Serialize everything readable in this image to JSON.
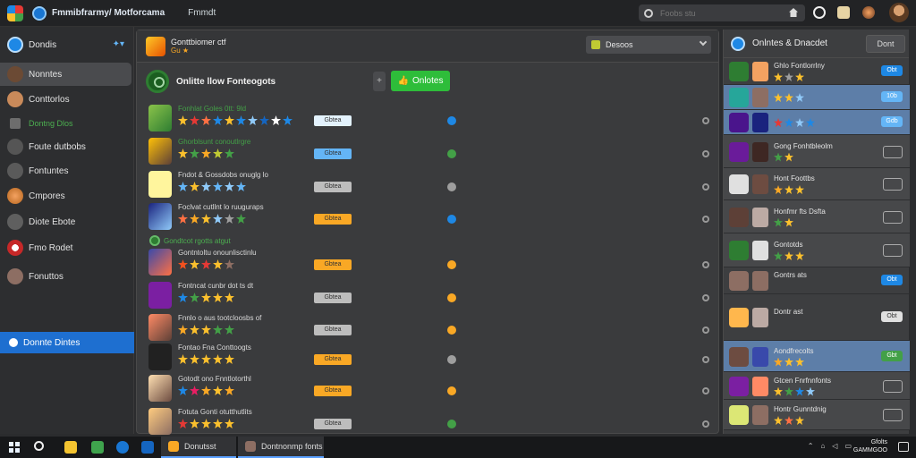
{
  "titlebar": {
    "app_title": "Fmmibfrarmy/ Motforcama",
    "subtitle": "Fmmdt",
    "search_placeholder": "Foobs stu"
  },
  "sidebar": {
    "top_label": "Dondis",
    "items": [
      {
        "label": "Nonntes",
        "active": true
      },
      {
        "label": "Conttorlos"
      },
      {
        "label": "Dontng Dlos",
        "green": true
      },
      {
        "label": "Foute dutbobs"
      },
      {
        "label": "Fontuntes"
      },
      {
        "label": "Cmpores"
      },
      {
        "label": "Diote Ebote"
      },
      {
        "label": "Fmo Rodet"
      },
      {
        "label": "Fonuttos"
      }
    ],
    "blue_item": "Donnte Dintes"
  },
  "main": {
    "header_title": "Gonttbiomer ctf",
    "header_sub": "Gu ★",
    "dropdown_value": "Desoos",
    "section_title": "Onlitte llow Fonteogots",
    "section_button": "Onlotes",
    "subsection_label": "Gondtcot rgotts atgut",
    "rows": [
      {
        "name": "Fonhlat Goles 0tt: 9ld",
        "badge": "Gbtea",
        "badge_color": "#e3f2fd",
        "dot_color": "#1e88e5",
        "name_green": true
      },
      {
        "name": "Ghorblsunt conoutlrgre",
        "badge": "Gbtea",
        "badge_color": "#64b5f6",
        "dot_color": "#43a047",
        "name_green": true
      },
      {
        "name": "Fndot & Gossdobs onuglg lo",
        "badge": "Gbtea",
        "badge_color": "#bdbdbd",
        "dot_color": "#9e9e9e"
      },
      {
        "name": "Foclvat cutllnt lo ruuguraps",
        "badge": "Gbtea",
        "badge_color": "#f9a825",
        "dot_color": "#1e88e5"
      },
      {
        "name": "Gontntoltu onounlisctinlu",
        "badge": "Gbtea",
        "badge_color": "#f9a825",
        "dot_color": "#f9a825"
      },
      {
        "name": "Fontncat cunbr dot ts dt",
        "badge": "Gbtea",
        "badge_color": "#bdbdbd",
        "dot_color": "#f9a825"
      },
      {
        "name": "Fnnlo o aus tootcloosbs of",
        "badge": "Gbtea",
        "badge_color": "#bdbdbd",
        "dot_color": "#f9a825"
      },
      {
        "name": "Fontao Fna Conttoogts",
        "badge": "Gbtea",
        "badge_color": "#f9a825",
        "dot_color": "#9e9e9e"
      },
      {
        "name": "Gotodt ono Fnntlotorthl",
        "badge": "Gbtea",
        "badge_color": "#f9a825",
        "dot_color": "#f9a825"
      },
      {
        "name": "Fotuta Gonti otutthutlits",
        "badge": "Gbtea",
        "badge_color": "#bdbdbd",
        "dot_color": "#43a047"
      }
    ]
  },
  "rpanel": {
    "title": "Onlntes & Dnacdet",
    "button": "Dont",
    "items": [
      {
        "name": "Ghlo Fontlorrlny",
        "tag": "Obt"
      },
      {
        "name": "",
        "tag": "10b"
      },
      {
        "name": "",
        "tag": "Gdb"
      },
      {
        "name": "Gong Fonhtbleolm"
      },
      {
        "name": "Hont Foottbs"
      },
      {
        "name": "Honfmr fts Dsfta"
      },
      {
        "name": "Gontotds"
      },
      {
        "name": "Gontrs ats",
        "tag": "Obt"
      },
      {
        "name": "Dontr ast",
        "tag": "Obt"
      },
      {
        "name": "Aondfrecolts",
        "tag": "Gbt"
      },
      {
        "name": "Gtcen Fnrfnnfonts"
      },
      {
        "name": "Hontr Gunntdnig"
      }
    ]
  },
  "taskbar": {
    "tab1": "Donutsst",
    "tab2": "Dontnonmp fonts",
    "clock_line1": "Gfolts",
    "clock_line2": "GAMMGOO"
  }
}
